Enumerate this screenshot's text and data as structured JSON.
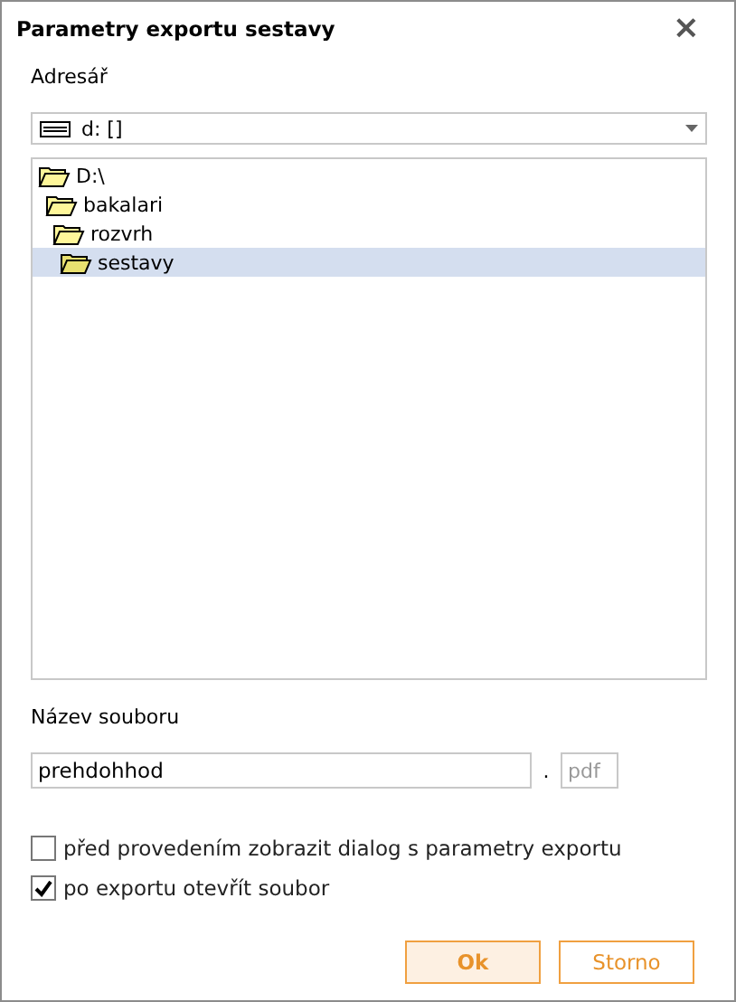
{
  "window": {
    "title": "Parametry exportu sestavy",
    "close": "×"
  },
  "directory": {
    "label": "Adresář",
    "drive": "d: []",
    "tree": [
      {
        "label": "D:\\",
        "selected": false,
        "children": [
          {
            "label": "bakalari",
            "selected": false,
            "children": [
              {
                "label": "rozvrh",
                "selected": false,
                "children": [
                  {
                    "label": "sestavy",
                    "selected": true
                  }
                ]
              }
            ]
          }
        ]
      }
    ]
  },
  "file": {
    "label": "Název souboru",
    "name": "prehdohhod",
    "dot": ".",
    "extension": "pdf"
  },
  "options": [
    {
      "label": "před provedením zobrazit dialog s parametry exportu",
      "checked": false
    },
    {
      "label": "po exportu otevřít soubor",
      "checked": true
    }
  ],
  "buttons": [
    {
      "label": "Ok",
      "kind": "primary"
    },
    {
      "label": "Storno",
      "kind": "secondary"
    }
  ]
}
